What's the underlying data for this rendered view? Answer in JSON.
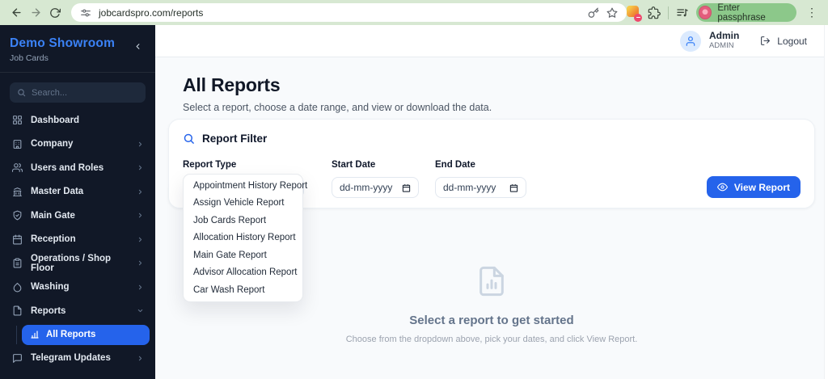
{
  "browser": {
    "url": "jobcardspro.com/reports",
    "profile_label": "Enter passphrase"
  },
  "icons": {
    "more_vertical": "⋮"
  },
  "sidebar": {
    "brand_title": "Demo Showroom",
    "brand_subtitle": "Job Cards",
    "search_placeholder": "Search...",
    "items": [
      {
        "label": "Dashboard"
      },
      {
        "label": "Company"
      },
      {
        "label": "Users and Roles"
      },
      {
        "label": "Master Data"
      },
      {
        "label": "Main Gate"
      },
      {
        "label": "Reception"
      },
      {
        "label": "Operations / Shop Floor"
      },
      {
        "label": "Washing"
      },
      {
        "label": "Reports"
      },
      {
        "label": "Telegram Updates"
      }
    ],
    "active_subitem": "All Reports"
  },
  "header": {
    "user_name": "Admin",
    "user_role": "ADMIN",
    "logout_label": "Logout"
  },
  "page": {
    "title": "All Reports",
    "subtitle": "Select a report, choose a date range, and view or download the data."
  },
  "filter": {
    "title": "Report Filter",
    "report_type_label": "Report Type",
    "start_date_label": "Start Date",
    "end_date_label": "End Date",
    "date_placeholder": "dd-mm-yyyy",
    "view_report_label": "View Report",
    "options": [
      "Appointment History Report",
      "Assign Vehicle Report",
      "Job Cards Report",
      "Allocation History Report",
      "Main Gate Report",
      "Advisor Allocation Report",
      "Car Wash Report"
    ]
  },
  "empty_state": {
    "title": "Select a report to get started",
    "subtitle": "Choose from the dropdown above, pick your dates, and click View Report."
  },
  "colors": {
    "accent": "#2563eb",
    "sidebar_bg": "#111827",
    "chrome_bg": "#d7e8d2",
    "profile_pill": "#8cc88a"
  }
}
